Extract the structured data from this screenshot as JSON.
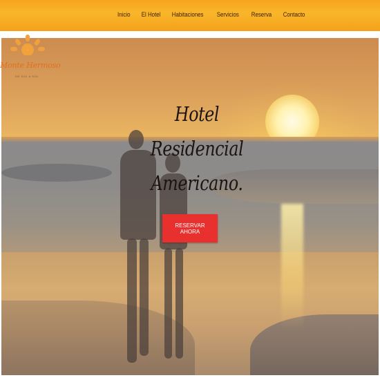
{
  "nav": {
    "items": [
      {
        "label": "Inicio"
      },
      {
        "label": "El Hotel"
      },
      {
        "label": "Habitaciones"
      },
      {
        "label": "Servicios"
      },
      {
        "label": "Reserva"
      },
      {
        "label": "Contacto"
      }
    ]
  },
  "logo": {
    "name": "Monte Hermoso",
    "tagline": "DE SOL A SOL"
  },
  "hero": {
    "title_line1": "Hotel Residencial",
    "title_line2": "Americano.",
    "cta_label": "RESERVAR AHORA"
  },
  "colors": {
    "nav_bar": "#f7a31c",
    "cta": "#e8302e",
    "logo_text": "#e2701e"
  }
}
